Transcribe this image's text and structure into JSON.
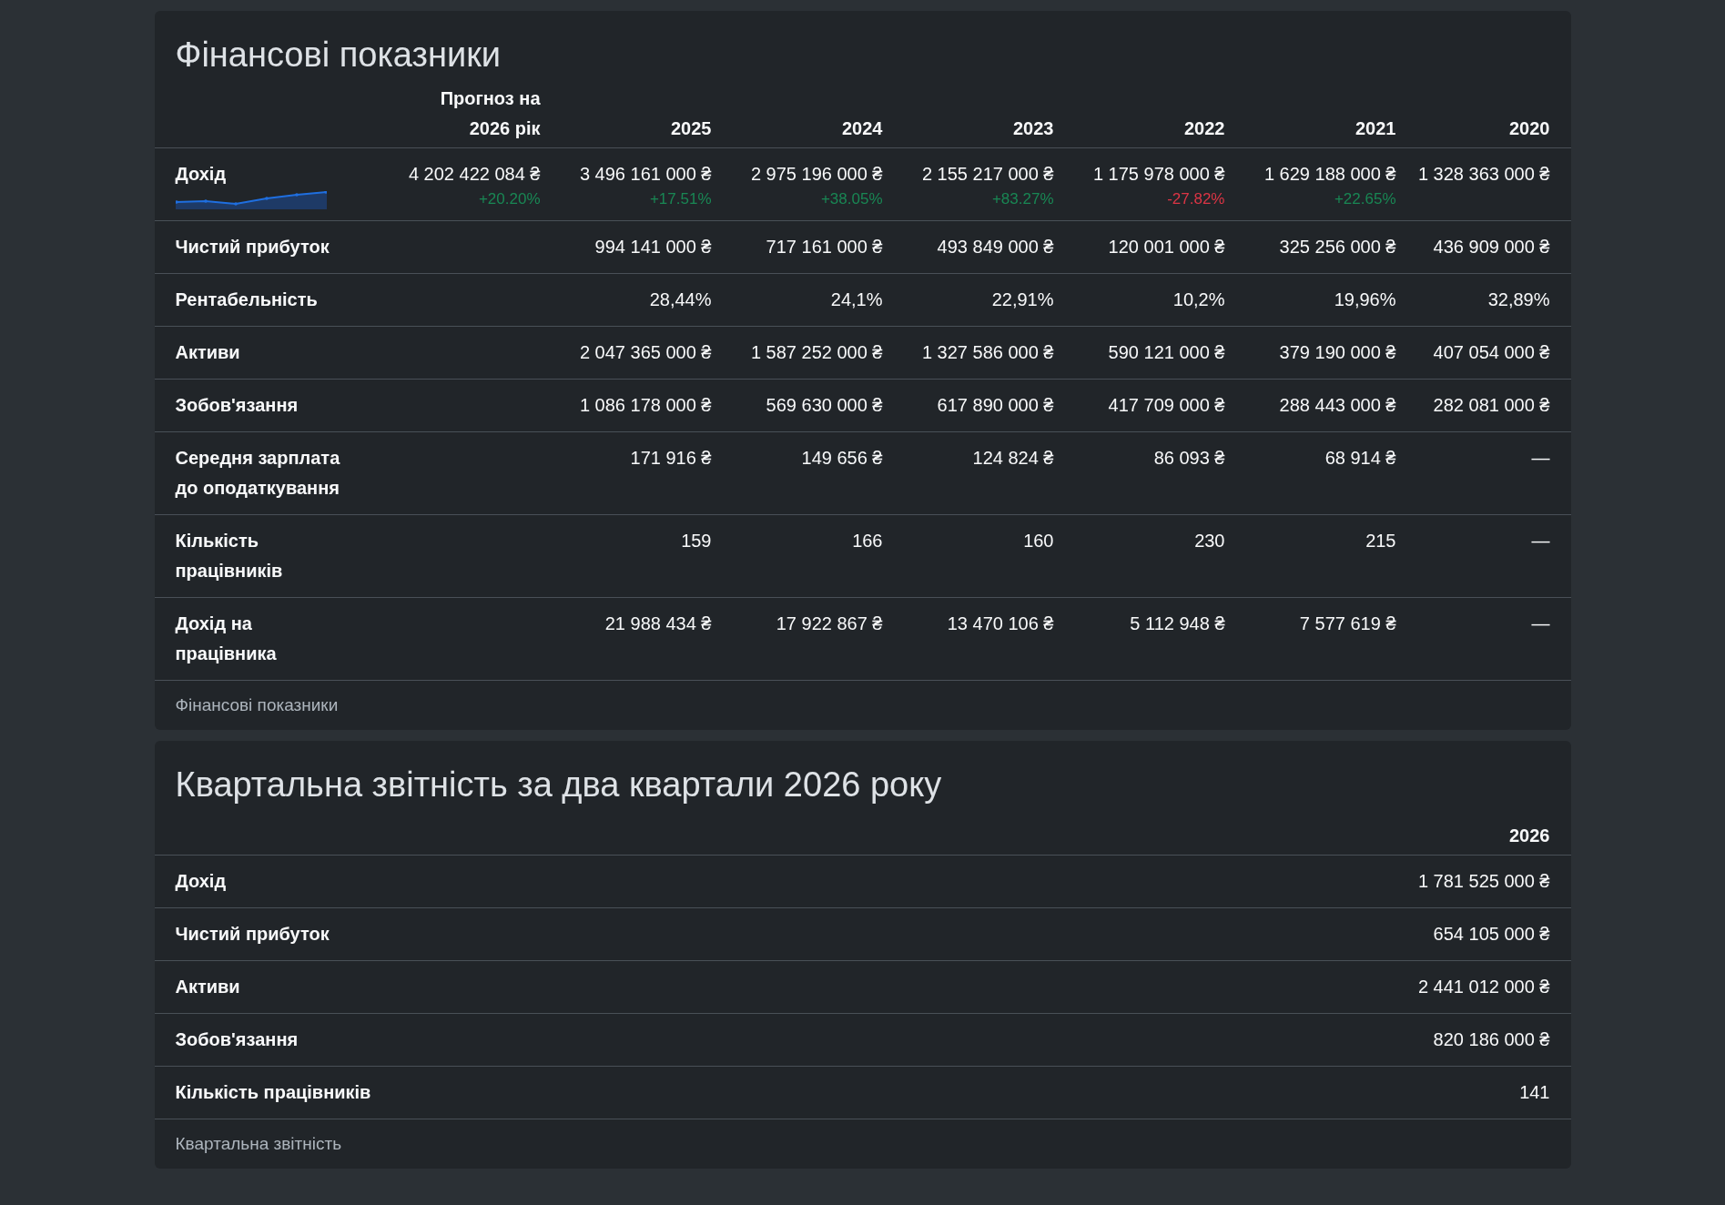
{
  "financials": {
    "title": "Фінансові показники",
    "columns": [
      "Прогноз на 2026 рік",
      "2025",
      "2024",
      "2023",
      "2022",
      "2021",
      "2020"
    ],
    "revenue": {
      "label": "Дохід",
      "forecast": {
        "value": "4 202 422 084 ₴",
        "change": "+20.20%",
        "color": "#198754"
      },
      "values": [
        {
          "value": "3 496 161 000 ₴",
          "change": "+17.51%",
          "color": "#198754"
        },
        {
          "value": "2 975 196 000 ₴",
          "change": "+38.05%",
          "color": "#198754"
        },
        {
          "value": "2 155 217 000 ₴",
          "change": "+83.27%",
          "color": "#198754"
        },
        {
          "value": "1 175 978 000 ₴",
          "change": "-27.82%",
          "color": "#dc3545"
        },
        {
          "value": "1 629 188 000 ₴",
          "change": "+22.65%",
          "color": "#198754"
        },
        {
          "value": "1 328 363 000 ₴"
        }
      ]
    },
    "rows": [
      {
        "label": "Чистий прибуток",
        "values": [
          "994 141 000 ₴",
          "717 161 000 ₴",
          "493 849 000 ₴",
          "120 001 000 ₴",
          "325 256 000 ₴",
          "436 909 000 ₴"
        ]
      },
      {
        "label": "Рентабельність",
        "values": [
          "28,44%",
          "24,1%",
          "22,91%",
          "10,2%",
          "19,96%",
          "32,89%"
        ]
      },
      {
        "label": "Активи",
        "values": [
          "2 047 365 000 ₴",
          "1 587 252 000 ₴",
          "1 327 586 000 ₴",
          "590 121 000 ₴",
          "379 190 000 ₴",
          "407 054 000 ₴"
        ]
      },
      {
        "label": "Зобов'язання",
        "values": [
          "1 086 178 000 ₴",
          "569 630 000 ₴",
          "617 890 000 ₴",
          "417 709 000 ₴",
          "288 443 000 ₴",
          "282 081 000 ₴"
        ]
      },
      {
        "label": "Середня зарплата до оподаткування",
        "values": [
          "171 916 ₴",
          "149 656 ₴",
          "124 824 ₴",
          "86 093 ₴",
          "68 914 ₴",
          "—"
        ]
      },
      {
        "label": "Кількість працівників",
        "values": [
          "159",
          "166",
          "160",
          "230",
          "215",
          "—"
        ]
      },
      {
        "label": "Дохід на працівника",
        "values": [
          "21 988 434 ₴",
          "17 922 867 ₴",
          "13 470 106 ₴",
          "5 112 948 ₴",
          "7 577 619 ₴",
          "—"
        ]
      }
    ],
    "caption": "Фінансові показники"
  },
  "quarterly": {
    "title": "Квартальна звітність за два квартали 2026 року",
    "columns": [
      "2026"
    ],
    "rows": [
      {
        "label": "Дохід",
        "values": [
          "1 781 525 000 ₴"
        ]
      },
      {
        "label": "Чистий прибуток",
        "values": [
          "654 105 000 ₴"
        ]
      },
      {
        "label": "Активи",
        "values": [
          "2 441 012 000 ₴"
        ]
      },
      {
        "label": "Зобов'язання",
        "values": [
          "820 186 000 ₴"
        ]
      },
      {
        "label": "Кількість працівників",
        "values": [
          "141"
        ]
      }
    ],
    "caption": "Квартальна звітність"
  }
}
